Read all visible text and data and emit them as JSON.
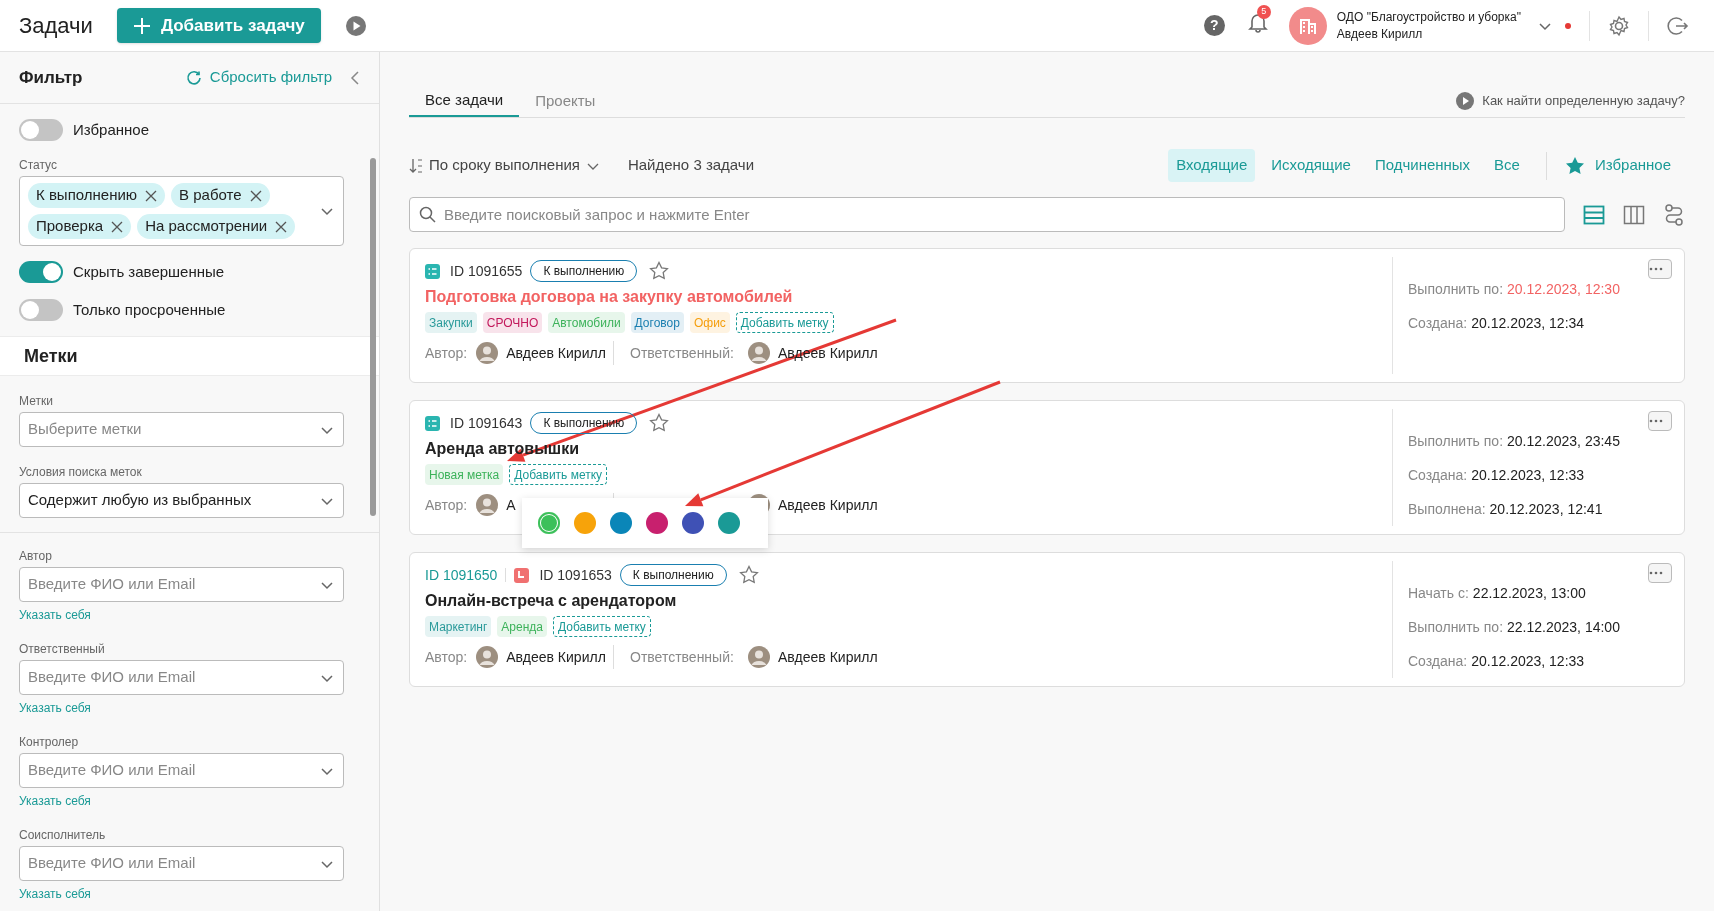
{
  "header": {
    "title": "Задачи",
    "help": "?",
    "add_button": "Добавить задачу",
    "notifications": "5",
    "org_name": "ОДО \"Благоустройство и уборка\"",
    "user_name": "Авдеев Кирилл"
  },
  "sidebar": {
    "title": "Фильтр",
    "reset": "Сбросить фильтр",
    "items": [
      {
        "kind": "toggle",
        "label": "Избранное",
        "on": false
      },
      {
        "kind": "chips",
        "label": "Статус",
        "chips": [
          "К выполнению",
          "В работе",
          "Проверка",
          "На рассмотрении"
        ]
      },
      {
        "kind": "toggle",
        "label": "Скрыть завершенные",
        "on": true
      },
      {
        "kind": "toggle",
        "label": "Только просроченные",
        "on": false
      },
      {
        "kind": "section",
        "label": "Метки"
      },
      {
        "kind": "select",
        "label": "Метки",
        "placeholder": "Выберите метки"
      },
      {
        "kind": "select",
        "label": "Условия поиска меток",
        "value": "Содержит любую из выбранных"
      },
      {
        "kind": "person",
        "label": "Автор",
        "placeholder": "Введите ФИО или Email",
        "link": "Указать себя"
      },
      {
        "kind": "person",
        "label": "Ответственный",
        "placeholder": "Введите ФИО или Email",
        "link": "Указать себя"
      },
      {
        "kind": "person",
        "label": "Контролер",
        "placeholder": "Введите ФИО или Email",
        "link": "Указать себя"
      },
      {
        "kind": "person",
        "label": "Соисполнитель",
        "placeholder": "Введите ФИО или Email",
        "link": "Указать себя"
      }
    ]
  },
  "tabs": [
    {
      "label": "Все задачи",
      "selected": true
    },
    {
      "label": "Проекты",
      "selected": false
    }
  ],
  "help_link": "Как найти определенную задачу?",
  "sort": "По сроку выполнения",
  "found": "Найдено 3 задачи",
  "filters": [
    {
      "label": "Входящие",
      "selected": true
    },
    {
      "label": "Исходящие",
      "selected": false
    },
    {
      "label": "Подчиненных",
      "selected": false
    },
    {
      "label": "Все",
      "selected": false
    }
  ],
  "favorites": "Избранное",
  "search": {
    "placeholder": "Введите поисковый запрос и нажмите Enter"
  },
  "views": [
    {
      "kind": "list",
      "selected": true
    },
    {
      "kind": "board",
      "selected": false
    },
    {
      "kind": "flow",
      "selected": false
    }
  ],
  "tasks": [
    {
      "kind": "list",
      "id": "ID 1091655",
      "status": "К выполнению",
      "title": "Подготовка договора на закупку автомобилей",
      "overdue": true,
      "tags": [
        {
          "label": "Закупки",
          "color": "#2a9a9a"
        },
        {
          "label": "СРОЧНО",
          "color": "#c2185b"
        },
        {
          "label": "Автомобили",
          "color": "#3cb25a"
        },
        {
          "label": "Договор",
          "color": "#1a7fb0"
        },
        {
          "label": "Офис",
          "color": "#f59e0b"
        }
      ],
      "add_tag": "Добавить метку",
      "people": [
        {
          "label": "Автор:",
          "name": "Авдеев Кирилл"
        },
        {
          "label": "Ответственный:",
          "name": "Авдеев Кирилл"
        }
      ],
      "dates": [
        {
          "kind": "due",
          "label": "Выполнить по:",
          "value": "20.12.2023, 12:30"
        },
        {
          "kind": "plain",
          "label": "Создана:",
          "value": "20.12.2023, 12:34"
        }
      ]
    },
    {
      "kind": "list",
      "id": "ID 1091643",
      "status": "К выполнению",
      "title": "Аренда автовышки",
      "overdue": false,
      "tags": [
        {
          "label": "Новая метка",
          "color": "#3cb25a"
        }
      ],
      "add_tag": "Добавить метку",
      "people": [
        {
          "label": "Автор:",
          "name": "А"
        },
        {
          "name": "Авдеев Кирилл"
        }
      ],
      "color_picker": [
        {
          "color": "#3cc05a",
          "selected": true
        },
        {
          "color": "#f7a30a",
          "selected": false
        },
        {
          "color": "#0a86b8",
          "selected": false
        },
        {
          "color": "#c8206e",
          "selected": false
        },
        {
          "color": "#3f51b5",
          "selected": false
        },
        {
          "color": "#1a9a96",
          "selected": false
        }
      ],
      "dates": [
        {
          "kind": "due",
          "label": "Выполнить по:",
          "value": "20.12.2023, 23:45"
        },
        {
          "kind": "plain",
          "label": "Создана:",
          "value": "20.12.2023, 12:33"
        },
        {
          "kind": "plain",
          "label": "Выполнена:",
          "value": "20.12.2023, 12:41"
        }
      ]
    },
    {
      "kind": "event",
      "parent_id": "ID 1091650",
      "id": "ID 1091653",
      "status": "К выполнению",
      "title": "Онлайн-встреча с арендатором",
      "overdue": false,
      "tags": [
        {
          "label": "Маркетинг",
          "color": "#2a9a9a"
        },
        {
          "label": "Аренда",
          "color": "#3cb25a"
        }
      ],
      "add_tag": "Добавить метку",
      "people": [
        {
          "label": "Автор:",
          "name": "Авдеев Кирилл"
        },
        {
          "label": "Ответственный:",
          "name": "Авдеев Кирилл"
        }
      ],
      "dates": [
        {
          "kind": "plain",
          "label": "Начать с:",
          "value": "22.12.2023, 13:00"
        },
        {
          "kind": "due",
          "label": "Выполнить по:",
          "value": "22.12.2023, 14:00"
        },
        {
          "kind": "plain",
          "label": "Создана:",
          "value": "20.12.2023, 12:33"
        }
      ]
    }
  ],
  "annotations": [
    {
      "kind": "arrow"
    },
    {
      "kind": "arrow"
    }
  ]
}
